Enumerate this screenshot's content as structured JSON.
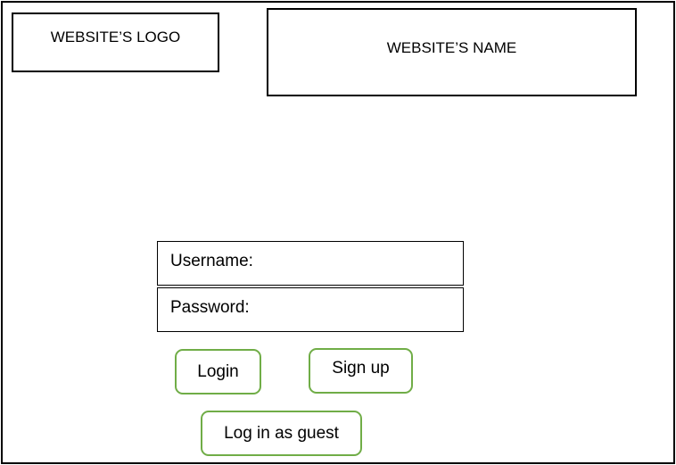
{
  "header": {
    "logo_text": "WEBSITE’S LOGO",
    "name_text": "WEBSITE’S NAME"
  },
  "login_form": {
    "username_label": "Username:",
    "password_label": "Password:"
  },
  "buttons": {
    "login": "Login",
    "signup": "Sign up",
    "guest": "Log in as guest"
  },
  "colors": {
    "button_border": "#70ad47",
    "outline": "#000000"
  }
}
